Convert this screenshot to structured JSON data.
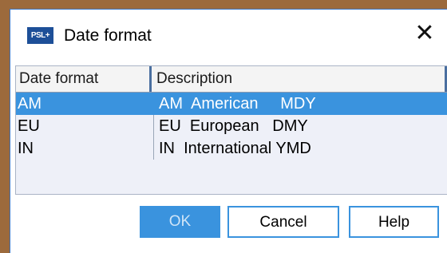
{
  "dialog": {
    "title": "Date format",
    "app_icon_text": "PSL+",
    "close_glyph": "✕"
  },
  "table": {
    "columns": [
      "Date format",
      "Description"
    ],
    "rows": [
      {
        "code": "AM",
        "description": "AM  American     MDY",
        "selected": true
      },
      {
        "code": "EU",
        "description": "EU  European   DMY",
        "selected": false
      },
      {
        "code": "IN",
        "description": "IN  International YMD",
        "selected": false
      }
    ]
  },
  "buttons": {
    "ok": "OK",
    "cancel": "Cancel",
    "help": "Help"
  },
  "colors": {
    "accent": "#3a93de",
    "background": "#9c6a3c"
  }
}
